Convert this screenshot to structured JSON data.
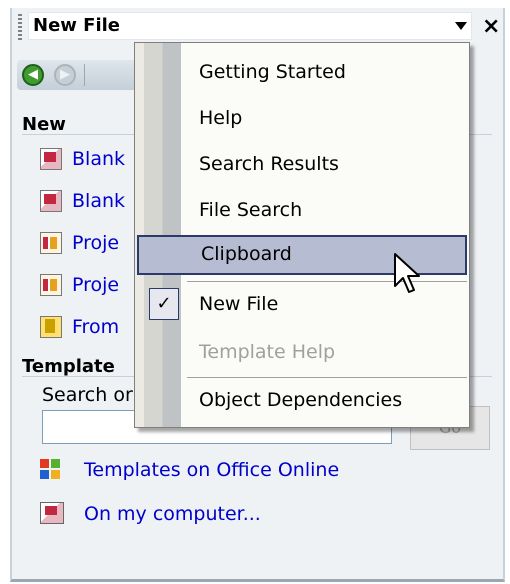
{
  "header": {
    "title": "New File",
    "close_label": "×"
  },
  "nav": {
    "back_glyph": "◀",
    "forward_glyph": "▶"
  },
  "new_section": {
    "title": "New",
    "items": [
      {
        "label": "Blank",
        "icon": "blank-doc-icon"
      },
      {
        "label": "Blank",
        "icon": "blank-doc-icon"
      },
      {
        "label": "Proje",
        "icon": "project-doc-icon"
      },
      {
        "label": "Proje",
        "icon": "project-doc-icon"
      },
      {
        "label": "From",
        "icon": "from-file-icon"
      }
    ]
  },
  "templates_section": {
    "title": "Template",
    "search_label": "Search or",
    "search_value": "",
    "go_label": "Go",
    "links": [
      {
        "label": "Templates on Office Online",
        "icon": "office-online-icon"
      },
      {
        "label": "On my computer...",
        "icon": "computer-doc-icon"
      }
    ]
  },
  "menu": {
    "items": [
      {
        "label": "Getting Started",
        "state": "normal"
      },
      {
        "label": "Help",
        "state": "normal"
      },
      {
        "label": "Search Results",
        "state": "normal"
      },
      {
        "label": "File Search",
        "state": "normal"
      },
      {
        "label": "Clipboard",
        "state": "highlighted"
      },
      {
        "label": "New File",
        "state": "checked",
        "check_glyph": "✓"
      },
      {
        "label": "Template Help",
        "state": "disabled"
      },
      {
        "label": "Object Dependencies",
        "state": "normal"
      }
    ]
  },
  "colors": {
    "link": "#0000cc",
    "highlight_bg": "#b6bdd2",
    "highlight_border": "#2a3a6b",
    "pane_bg": "#eef2f5"
  }
}
